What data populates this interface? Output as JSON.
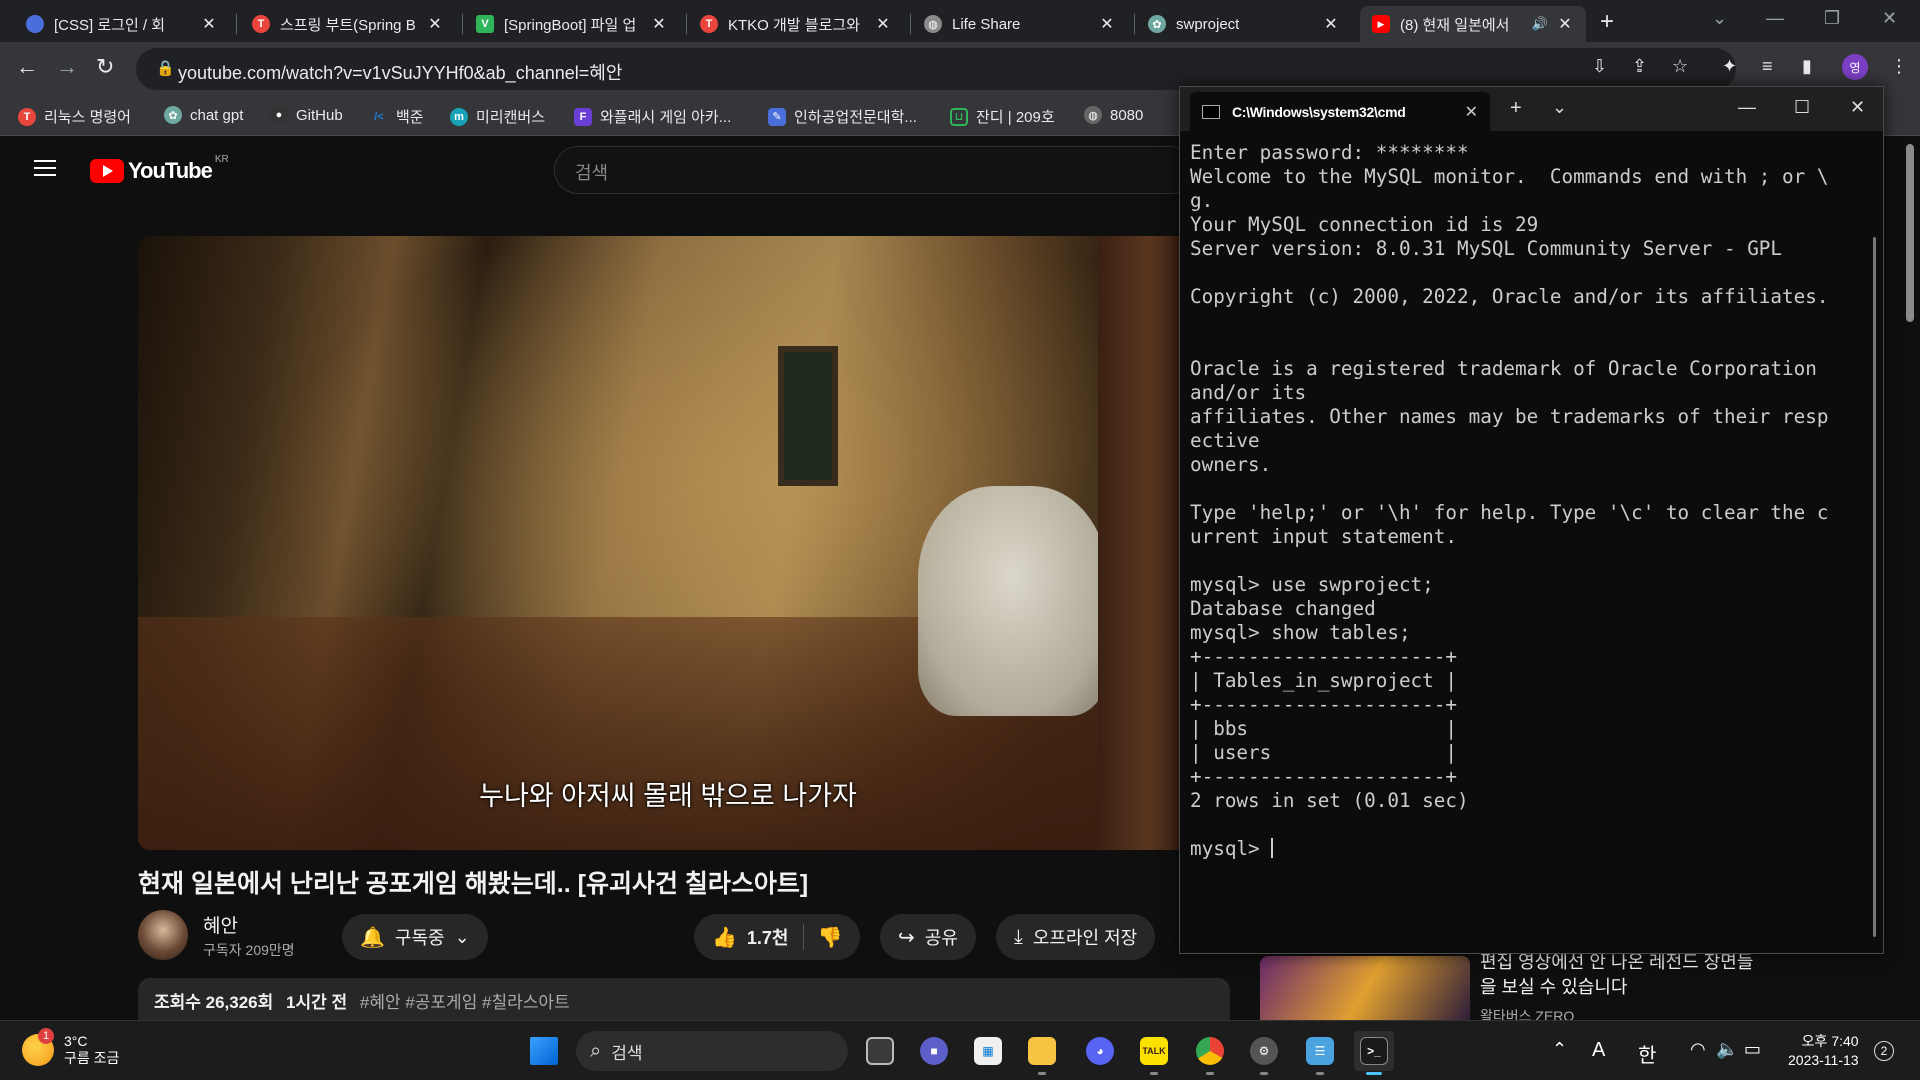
{
  "browser": {
    "tabs": [
      {
        "label": "[CSS] 로그인 / 회",
        "color": "#4a6fdc"
      },
      {
        "label": "스프링 부트(Spring B",
        "color": "#e8453c"
      },
      {
        "label": "[SpringBoot] 파일 업",
        "color": "#2fb65a"
      },
      {
        "label": "KTKO 개발 블로그와",
        "color": "#e8453c"
      },
      {
        "label": "Life Share",
        "color": "#8a8a8a"
      },
      {
        "label": "swproject",
        "color": "#6fa8a0"
      },
      {
        "label": "(8) 현재 일본에서",
        "color": "#ff0000"
      }
    ],
    "url": "youtube.com/watch?v=v1vSuJYYHf0&ab_channel=혜안",
    "profile_initial": "영",
    "bookmarks": [
      {
        "label": "리눅스 명령어",
        "color": "#e8453c"
      },
      {
        "label": "chat gpt",
        "color": "#6fa8a0"
      },
      {
        "label": "GitHub",
        "color": "#333333"
      },
      {
        "label": "백준",
        "color": "#1e7bd6"
      },
      {
        "label": "미리캔버스",
        "color": "#17a2b8"
      },
      {
        "label": "와플래시 게임 아카...",
        "color": "#6a3fd6"
      },
      {
        "label": "인하공업전문대학...",
        "color": "#4a6fdc"
      },
      {
        "label": "잔디 | 209호",
        "color": "#2fb65a"
      },
      {
        "label": "8080",
        "color": "#666666"
      }
    ]
  },
  "youtube": {
    "logo_text": "YouTube",
    "region": "KR",
    "search_placeholder": "검색",
    "subtitle": "누나와 아저씨 몰래 밖으로 나가자",
    "video_title": "현재 일본에서 난리난 공포게임 해봤는데.. [유괴사건 칠라스아트]",
    "channel_name": "혜안",
    "subscriber_count": "구독자 209만명",
    "subscribe_label": "구독중",
    "like_count": "1.7천",
    "share_label": "공유",
    "download_label": "오프라인 저장",
    "view_count": "조회수 26,326회",
    "uploaded": "1시간 전",
    "hashtags": "#혜안 #공포게임 #칠라스아트",
    "side_video_title": "편집 영상에선 안 나온 레전드 장면들을 보실 수 있습니다",
    "side_video_channel": "왈타버스 ZERO"
  },
  "cmd": {
    "title": "C:\\Windows\\system32\\cmd",
    "lines": [
      "Enter password: ********",
      "Welcome to the MySQL monitor.  Commands end with ; or \\",
      "g.",
      "Your MySQL connection id is 29",
      "Server version: 8.0.31 MySQL Community Server - GPL",
      "",
      "Copyright (c) 2000, 2022, Oracle and/or its affiliates.",
      "",
      "",
      "Oracle is a registered trademark of Oracle Corporation",
      "and/or its",
      "affiliates. Other names may be trademarks of their resp",
      "ective",
      "owners.",
      "",
      "Type 'help;' or '\\h' for help. Type '\\c' to clear the c",
      "urrent input statement.",
      "",
      "mysql> use swproject;",
      "Database changed",
      "mysql> show tables;",
      "+---------------------+",
      "| Tables_in_swproject |",
      "+---------------------+",
      "| bbs                 |",
      "| users               |",
      "+---------------------+",
      "2 rows in set (0.01 sec)",
      ""
    ],
    "prompt": "mysql> "
  },
  "taskbar": {
    "weather_temp": "3°C",
    "weather_desc": "구름 조금",
    "weather_badge": "1",
    "search_label": "검색",
    "ime_a": "A",
    "ime_lang": "한",
    "time": "오후 7:40",
    "date": "2023-11-13",
    "notification_count": "2"
  }
}
